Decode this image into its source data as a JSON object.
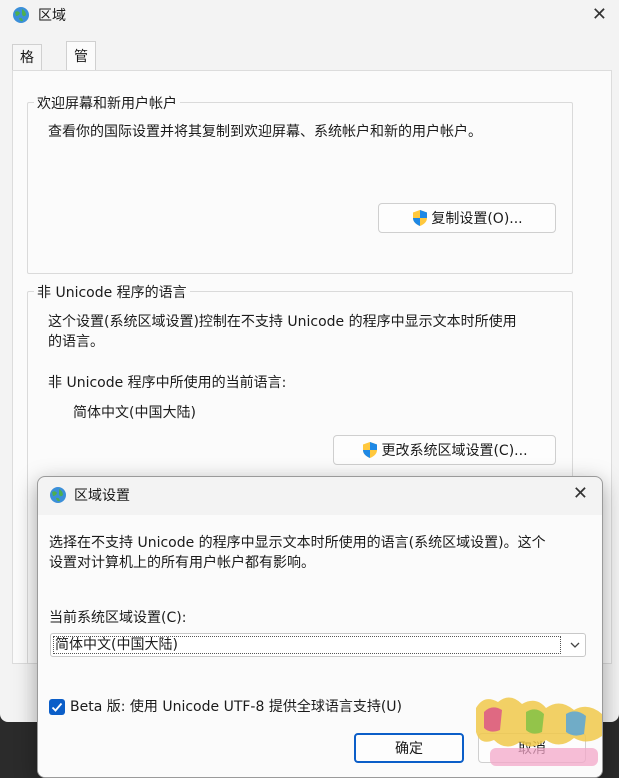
{
  "window": {
    "title": "区域",
    "close_glyph": "✕",
    "tabs": [
      {
        "label": "格式"
      },
      {
        "label": "管理"
      }
    ]
  },
  "welcome_group": {
    "title": "欢迎屏幕和新用户帐户",
    "description": "查看你的国际设置并将其复制到欢迎屏幕、系统帐户和新的用户帐户。",
    "copy_button": "复制设置(O)..."
  },
  "nonunicode_group": {
    "title": "非 Unicode 程序的语言",
    "description_line1": "这个设置(系统区域设置)控制在不支持 Unicode 的程序中显示文本时所使用",
    "description_line2": "的语言。",
    "current_label": "非 Unicode 程序中所使用的当前语言:",
    "current_value": "简体中文(中国大陆)",
    "change_button": "更改系统区域设置(C)..."
  },
  "dialog": {
    "title": "区域设置",
    "close_glyph": "✕",
    "description_line1": "选择在不支持 Unicode 的程序中显示文本时所使用的语言(系统区域设置)。这个",
    "description_line2": "设置对计算机上的所有用户帐户都有影响。",
    "locale_label": "当前系统区域设置(C):",
    "locale_value": "简体中文(中国大陆)",
    "beta_checkbox_label": "Beta 版: 使用 Unicode UTF-8 提供全球语言支持(U)",
    "beta_checked": true,
    "ok_button": "确定",
    "cancel_button": "取消"
  },
  "colors": {
    "accent": "#0b5ec8",
    "window_bg": "#f3f3f3"
  },
  "icons": {
    "globe": "globe-icon",
    "shield": "uac-shield-icon",
    "chevron": "chevron-down-icon",
    "checkmark": "checkmark-icon"
  }
}
